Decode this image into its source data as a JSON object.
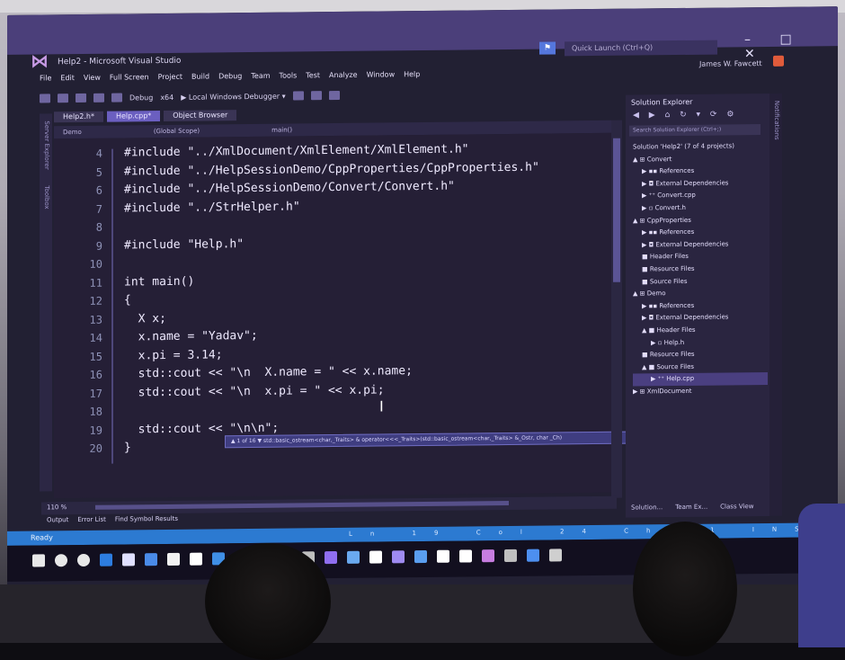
{
  "window": {
    "title": "Help2 - Microsoft Visual Studio",
    "quick_launch": "Quick Launch (Ctrl+Q)",
    "user": "James W. Fawcett",
    "controls": "– □ ✕"
  },
  "menu": [
    "File",
    "Edit",
    "View",
    "Full Screen",
    "Project",
    "Build",
    "Debug",
    "Team",
    "Tools",
    "Test",
    "Analyze",
    "Window",
    "Help"
  ],
  "toolbar": {
    "config": "Debug",
    "platform": "x64",
    "debugger": "▶ Local Windows Debugger ▾"
  },
  "left_strip": {
    "server": "Server Explorer",
    "toolbox": "Toolbox"
  },
  "tabs": [
    {
      "label": "Help2.h*",
      "active": false
    },
    {
      "label": "Help.cpp*",
      "active": true
    },
    {
      "label": "Object Browser",
      "active": false
    }
  ],
  "navbar": {
    "project": "Demo",
    "scope": "(Global Scope)",
    "member": "main()"
  },
  "editor": {
    "lines": [
      {
        "n": "4",
        "code": "#include \"../XmlDocument/XmlElement/XmlElement.h\""
      },
      {
        "n": "5",
        "code": "#include \"../HelpSessionDemo/CppProperties/CppProperties.h\""
      },
      {
        "n": "6",
        "code": "#include \"../HelpSessionDemo/Convert/Convert.h\""
      },
      {
        "n": "7",
        "code": "#include \"../StrHelper.h\""
      },
      {
        "n": "8",
        "code": ""
      },
      {
        "n": "9",
        "code": "#include \"Help.h\""
      },
      {
        "n": "10",
        "code": ""
      },
      {
        "n": "11",
        "code": "int main()"
      },
      {
        "n": "12",
        "code": "{"
      },
      {
        "n": "13",
        "code": "  X x;"
      },
      {
        "n": "14",
        "code": "  x.name = \"Yadav\";"
      },
      {
        "n": "15",
        "code": "  x.pi = 3.14;"
      },
      {
        "n": "16",
        "code": "  std::cout << \"\\n  X.name = \" << x.name;"
      },
      {
        "n": "17",
        "code": "  std::cout << \"\\n  x.pi = \" << x.pi;"
      },
      {
        "n": "18",
        "code": ""
      },
      {
        "n": "19",
        "code": "  std::cout << \"\\n\\n\";"
      },
      {
        "n": "20",
        "code": "}"
      }
    ],
    "tooltip": "▲ 1 of 16 ▼  std::basic_ostream<char,_Traits> & operator<<<_Traits>(std::basic_ostream<char,_Traits> &_Ostr, char _Ch)"
  },
  "zoom": "110 %",
  "output_tabs": [
    "Output",
    "Error List",
    "Find Symbol Results"
  ],
  "status": {
    "text": "Ready",
    "items": [
      "Ln 19",
      "Col 24",
      "Ch 21",
      "INS"
    ]
  },
  "solution": {
    "title": "Solution Explorer",
    "icons": "◀ ▶ ⌂ ↻ ▾ ⟳ ⚙",
    "search": "Search Solution Explorer (Ctrl+;)",
    "tree": [
      {
        "label": "Solution 'Help2' (7 of 4 projects)",
        "indent": 0
      },
      {
        "label": "▲ ⊞ Convert",
        "indent": 0
      },
      {
        "label": "▶ ▪▪ References",
        "indent": 1
      },
      {
        "label": "▶ ◘ External Dependencies",
        "indent": 1
      },
      {
        "label": "▶ ⁺⁺ Convert.cpp",
        "indent": 1
      },
      {
        "label": "▶ ▫ Convert.h",
        "indent": 1
      },
      {
        "label": "▲ ⊞ CppProperties",
        "indent": 0
      },
      {
        "label": "▶ ▪▪ References",
        "indent": 1
      },
      {
        "label": "▶ ◘ External Dependencies",
        "indent": 1
      },
      {
        "label": "■ Header Files",
        "indent": 1
      },
      {
        "label": "■ Resource Files",
        "indent": 1
      },
      {
        "label": "■ Source Files",
        "indent": 1
      },
      {
        "label": "▲ ⊞ Demo",
        "indent": 0
      },
      {
        "label": "▶ ▪▪ References",
        "indent": 1
      },
      {
        "label": "▶ ◘ External Dependencies",
        "indent": 1
      },
      {
        "label": "▲ ■ Header Files",
        "indent": 1
      },
      {
        "label": "▶ ▫ Help.h",
        "indent": 2
      },
      {
        "label": "■ Resource Files",
        "indent": 1
      },
      {
        "label": "▲ ■ Source Files",
        "indent": 1
      },
      {
        "label": "▶ ⁺⁺ Help.cpp",
        "indent": 2,
        "selected": true
      },
      {
        "label": "▶ ⊞ XmlDocument",
        "indent": 0
      }
    ],
    "bottom_tabs": [
      "Solution...",
      "Team Ex...",
      "Class View"
    ]
  },
  "colors": {
    "title_bar": "#4b3f7a",
    "editor_bg": "#251f36",
    "status_bar": "#2c7ad1",
    "tab_active": "#6b5fc0"
  },
  "taskbar_colors": [
    "#e8e8e8",
    "#e8e8e8",
    "#e8e8e8",
    "#2d7de0",
    "#e0e0ff",
    "#4a8be8",
    "#f2f2f2",
    "#ffffff",
    "#3f8fe6",
    "#9a6cf0",
    "#ffffff",
    "#2f6fd8",
    "#bfbfbf",
    "#8f6ef0",
    "#6aa9f0",
    "#ffffff",
    "#9f8bf2",
    "#5a9ef0",
    "#ffffff",
    "#ffffff",
    "#c77de0",
    "#bfbfbf",
    "#4d8fef",
    "#cfcfcf"
  ]
}
